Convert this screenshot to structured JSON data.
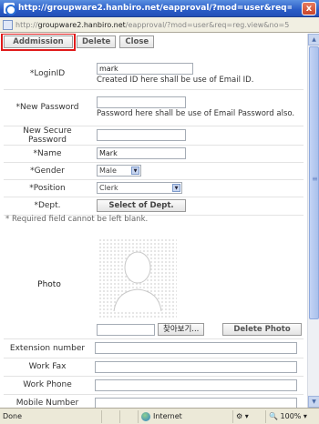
{
  "window": {
    "title": "http://groupware2.hanbiro.net/eapproval/?mod=user&req=reg.vie...",
    "close_glyph": "x",
    "url_prefix": "http://",
    "url_host": "groupware2.hanbiro.net",
    "url_path": "/eapproval/?mod=user&req=reg.view&no=5"
  },
  "toolbar": {
    "addmission_label": "Addmission",
    "delete_label": "Delete",
    "close_label": "Close"
  },
  "form": {
    "login_label": "*LoginID",
    "login_value": "mark",
    "login_hint": "Created ID here shall be use of Email ID.",
    "new_password_label": "*New Password",
    "new_password_hint": "Password here shall be use of Email Password also.",
    "new_secure_password_label": "New Secure Password",
    "name_label": "*Name",
    "name_value": "Mark",
    "gender_label": "*Gender",
    "gender_value": "Male",
    "position_label": "*Position",
    "position_value": "Clerk",
    "dept_label": "*Dept.",
    "dept_button_label": "Select of Dept.",
    "required_note": "* Required field cannot be left blank."
  },
  "photo": {
    "label": "Photo",
    "browse_label": "찾아보기...",
    "delete_photo_label": "Delete Photo"
  },
  "extra": {
    "extension_label": "Extension number",
    "work_fax_label": "Work Fax",
    "work_phone_label": "Work Phone",
    "mobile_label": "Mobile Number"
  },
  "status": {
    "done": "Done",
    "zone": "Internet",
    "zoom": "100%"
  },
  "colors": {
    "highlight": "#e01a1a",
    "titlebar": "#2a5cc6"
  }
}
